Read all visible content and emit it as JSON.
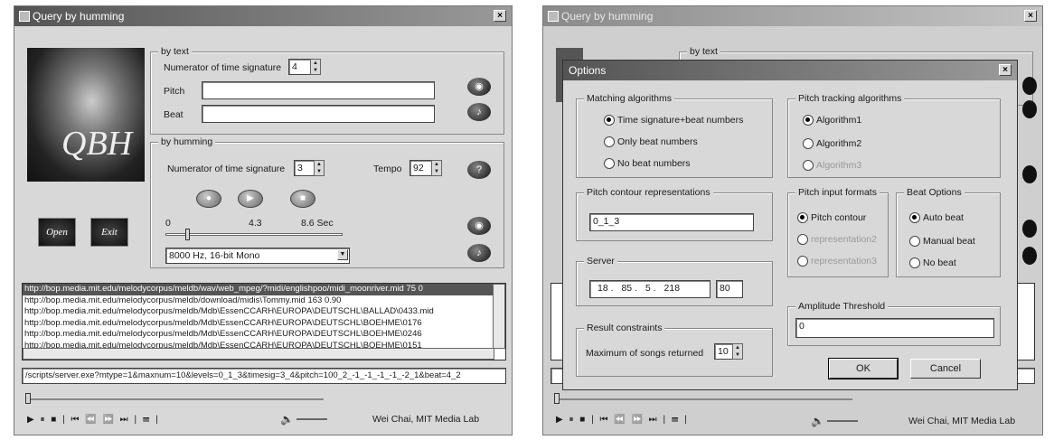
{
  "left_window": {
    "title": "Query by humming",
    "close_glyph": "×",
    "logo_text": "QBH",
    "open_button": "Open",
    "exit_button": "Exit",
    "by_text": {
      "legend": "by text",
      "numerator_label": "Numerator of time signature",
      "numerator_value": "4",
      "pitch_label": "Pitch",
      "pitch_value": "",
      "beat_label": "Beat",
      "beat_value": ""
    },
    "by_humming": {
      "legend": "by humming",
      "numerator_label": "Numerator of time signature",
      "numerator_value": "3",
      "tempo_label": "Tempo",
      "tempo_value": "92",
      "slider_min": "0",
      "slider_mid": "4.3",
      "slider_max": "8.6 Sec",
      "format_value": "8000 Hz, 16-bit Mono"
    },
    "results": [
      "http://bop.media.mit.edu/melodycorpus/meldb/wav/web_mpeg/?midi/englishpoo/midi_moonriver.mid 75 0",
      "http://bop.media.mit.edu/melodycorpus/meldb/download/midis\\Tommy.mid 163 0.90",
      "http://bop.media.mit.edu/melodycorpus/meldb/Mdb\\EssenCCARH\\EUROPA\\DEUTSCHL\\BALLAD\\0433.mid",
      "http://bop.media.mit.edu/melodycorpus/meldb/Mdb\\EssenCCARH\\EUROPA\\DEUTSCHL\\BOEHME\\0176",
      "http://bop.media.mit.edu/melodycorpus/meldb/Mdb\\EssenCCARH\\EUROPA\\DEUTSCHL\\BOEHME\\0246",
      "http://bop.media.mit.edu/melodycorpus/meldb/Mdb\\EssenCCARH\\EUROPA\\DEUTSCHL\\BOEHME\\0151"
    ],
    "query_url": "/scripts/server.exe?mtype=1&maxnum=10&levels=0_1_3&timesig=3_4&pitch=100_2_-1_-1_-1_-1_-2_1&beat=4_2",
    "transport": "▶ ⏸ ■ | ⏮ ⏪ ⏩ ⏭ | ☰ |",
    "credit": "Wei Chai, MIT Media Lab"
  },
  "right_window": {
    "title": "Query by humming",
    "close_glyph": "×",
    "by_text_legend": "by text",
    "transport": "▶ ⏸ ■ | ⏮ ⏪ ⏩ ⏭ | ☰ |",
    "credit": "Wei Chai, MIT Media Lab"
  },
  "options_dialog": {
    "title": "Options",
    "close_glyph": "×",
    "matching": {
      "legend": "Matching algorithms",
      "options": [
        "Time signature+beat numbers",
        "Only beat numbers",
        "No beat numbers"
      ]
    },
    "pitch_tracking": {
      "legend": "Pitch tracking algorithms",
      "options": [
        "Algorithm1",
        "Algorithm2",
        "Algorithm3"
      ]
    },
    "contour": {
      "legend": "Pitch contour representations",
      "value": "0_1_3"
    },
    "pitch_input": {
      "legend": "Pitch input formats",
      "options": [
        "Pitch contour",
        "representation2",
        "representation3"
      ]
    },
    "beat_options": {
      "legend": "Beat Options",
      "options": [
        "Auto beat",
        "Manual beat",
        "No beat"
      ]
    },
    "server": {
      "legend": "Server",
      "ip": [
        "18",
        "85",
        "5",
        "218"
      ],
      "port": "80"
    },
    "amplitude": {
      "legend": "Amplitude Threshold",
      "value": "0"
    },
    "result_constraints": {
      "legend": "Result constraints",
      "max_label": "Maximum of songs returned",
      "max_value": "10"
    },
    "ok_label": "OK",
    "cancel_label": "Cancel"
  }
}
